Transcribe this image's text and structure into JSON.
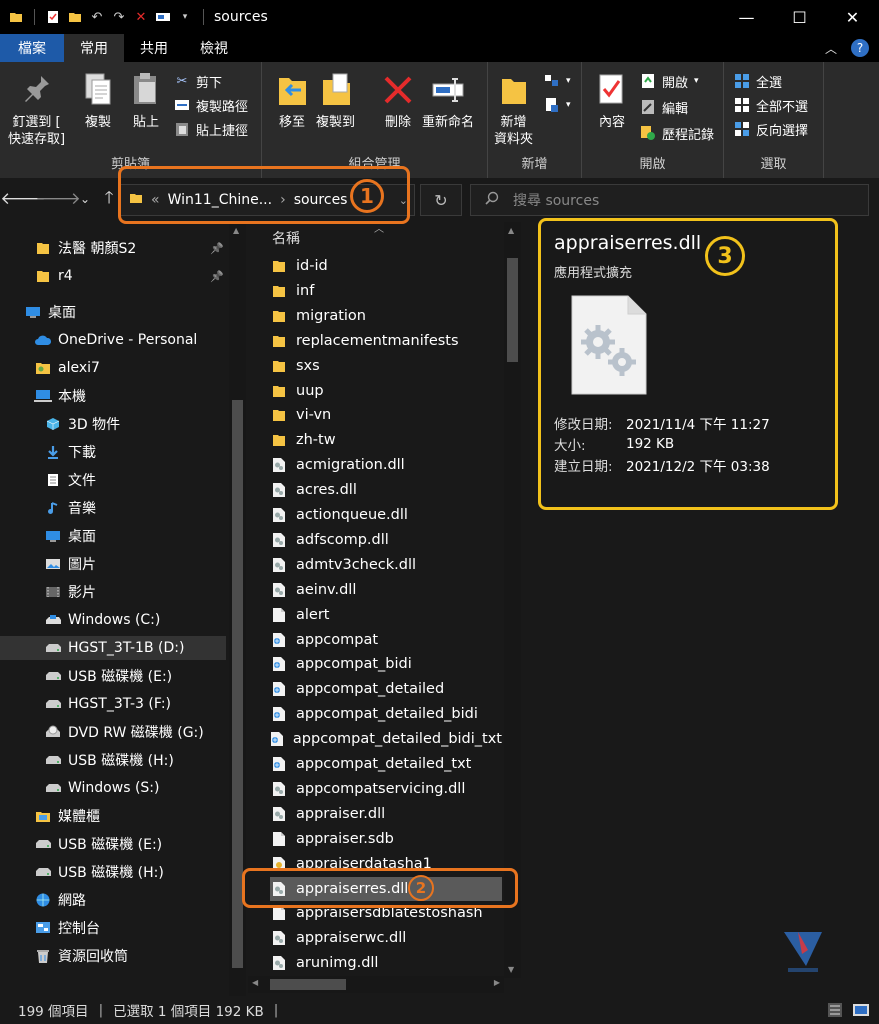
{
  "window": {
    "title": "sources",
    "minimize": "—",
    "maximize": "☐",
    "close": "✕"
  },
  "ribbon_tabs": [
    "檔案",
    "常用",
    "共用",
    "檢視"
  ],
  "ribbon": {
    "clipboard": {
      "label": "剪貼簿",
      "pin_line1": "釘選到 [",
      "pin_line2": "快速存取]",
      "copy": "複製",
      "paste": "貼上",
      "cut": "剪下",
      "copy_path": "複製路徑",
      "paste_shortcut": "貼上捷徑"
    },
    "organize": {
      "label": "組合管理",
      "move_to": "移至",
      "copy_to": "複製到",
      "delete": "刪除",
      "rename": "重新命名"
    },
    "new": {
      "label": "新增",
      "new_folder_line1": "新增",
      "new_folder_line2": "資料夾"
    },
    "open": {
      "label": "開啟",
      "properties": "內容",
      "open": "開啟",
      "edit": "編輯",
      "history": "歷程記錄"
    },
    "select": {
      "label": "選取",
      "select_all": "全選",
      "select_none": "全部不選",
      "invert": "反向選擇"
    }
  },
  "address": {
    "prefix": "«",
    "crumb1": "Win11_Chine...",
    "sep": "›",
    "crumb2": "sources",
    "search_placeholder": "搜尋 sources"
  },
  "nav": [
    {
      "label": "法醫 朝顏S2",
      "icon": "folder-icon",
      "pinned": true
    },
    {
      "label": "r4",
      "icon": "folder-icon",
      "pinned": true
    },
    {
      "label": "桌面",
      "icon": "desktop-icon"
    },
    {
      "label": "OneDrive - Personal",
      "icon": "cloud-icon"
    },
    {
      "label": "alexi7",
      "icon": "user-folder-icon"
    },
    {
      "label": "本機",
      "icon": "computer-icon"
    },
    {
      "label": "3D 物件",
      "icon": "cube-icon"
    },
    {
      "label": "下載",
      "icon": "download-icon"
    },
    {
      "label": "文件",
      "icon": "document-icon"
    },
    {
      "label": "音樂",
      "icon": "music-icon"
    },
    {
      "label": "桌面",
      "icon": "desktop-icon"
    },
    {
      "label": "圖片",
      "icon": "picture-icon"
    },
    {
      "label": "影片",
      "icon": "video-icon"
    },
    {
      "label": "Windows (C:)",
      "icon": "system-drive-icon"
    },
    {
      "label": "HGST_3T-1B (D:)",
      "icon": "drive-icon",
      "selected": true
    },
    {
      "label": "USB 磁碟機 (E:)",
      "icon": "drive-icon"
    },
    {
      "label": "HGST_3T-3 (F:)",
      "icon": "drive-icon"
    },
    {
      "label": "DVD RW 磁碟機 (G:)",
      "icon": "dvd-icon"
    },
    {
      "label": "USB 磁碟機 (H:)",
      "icon": "drive-icon"
    },
    {
      "label": "Windows (S:)",
      "icon": "drive-icon"
    },
    {
      "label": "媒體櫃",
      "icon": "library-icon"
    },
    {
      "label": "USB 磁碟機 (E:)",
      "icon": "drive-icon"
    },
    {
      "label": "USB 磁碟機 (H:)",
      "icon": "drive-icon"
    },
    {
      "label": "網路",
      "icon": "network-icon"
    },
    {
      "label": "控制台",
      "icon": "control-panel-icon"
    },
    {
      "label": "資源回收筒",
      "icon": "recycle-bin-icon"
    }
  ],
  "files": {
    "column_name": "名稱",
    "items": [
      {
        "name": "id-id",
        "type": "folder"
      },
      {
        "name": "inf",
        "type": "folder"
      },
      {
        "name": "migration",
        "type": "folder"
      },
      {
        "name": "replacementmanifests",
        "type": "folder"
      },
      {
        "name": "sxs",
        "type": "folder"
      },
      {
        "name": "uup",
        "type": "folder"
      },
      {
        "name": "vi-vn",
        "type": "folder"
      },
      {
        "name": "zh-tw",
        "type": "folder"
      },
      {
        "name": "acmigration.dll",
        "type": "dll"
      },
      {
        "name": "acres.dll",
        "type": "dll"
      },
      {
        "name": "actionqueue.dll",
        "type": "dll"
      },
      {
        "name": "adfscomp.dll",
        "type": "dll"
      },
      {
        "name": "admtv3check.dll",
        "type": "dll"
      },
      {
        "name": "aeinv.dll",
        "type": "dll"
      },
      {
        "name": "alert",
        "type": "file"
      },
      {
        "name": "appcompat",
        "type": "xml"
      },
      {
        "name": "appcompat_bidi",
        "type": "xml"
      },
      {
        "name": "appcompat_detailed",
        "type": "xml"
      },
      {
        "name": "appcompat_detailed_bidi",
        "type": "xml"
      },
      {
        "name": "appcompat_detailed_bidi_txt",
        "type": "xml"
      },
      {
        "name": "appcompat_detailed_txt",
        "type": "xml"
      },
      {
        "name": "appcompatservicing.dll",
        "type": "dll"
      },
      {
        "name": "appraiser.dll",
        "type": "dll"
      },
      {
        "name": "appraiser.sdb",
        "type": "file"
      },
      {
        "name": "appraiserdatasha1",
        "type": "cert"
      },
      {
        "name": "appraiserres.dll",
        "type": "dll",
        "selected": true
      },
      {
        "name": "appraisersdblatestoshash",
        "type": "file"
      },
      {
        "name": "appraiserwc.dll",
        "type": "dll"
      },
      {
        "name": "arunimg.dll",
        "type": "dll"
      }
    ]
  },
  "details": {
    "name": "appraiserres.dll",
    "type": "應用程式擴充",
    "props": [
      {
        "key": "修改日期:",
        "value": "2021/11/4 下午 11:27"
      },
      {
        "key": "大小:",
        "value": "192 KB"
      },
      {
        "key": "建立日期:",
        "value": "2021/12/2 下午 03:38"
      }
    ]
  },
  "status": {
    "count": "199 個項目",
    "selected": "已選取 1 個項目  192 KB",
    "bar": "|"
  },
  "annotations": {
    "one": "1",
    "two": "2",
    "three": "3"
  },
  "colors": {
    "accent_file_tab": "#1e5aa8",
    "annotation_orange": "#e8741f",
    "annotation_yellow": "#f2c21b",
    "folder": "#f5c343"
  }
}
